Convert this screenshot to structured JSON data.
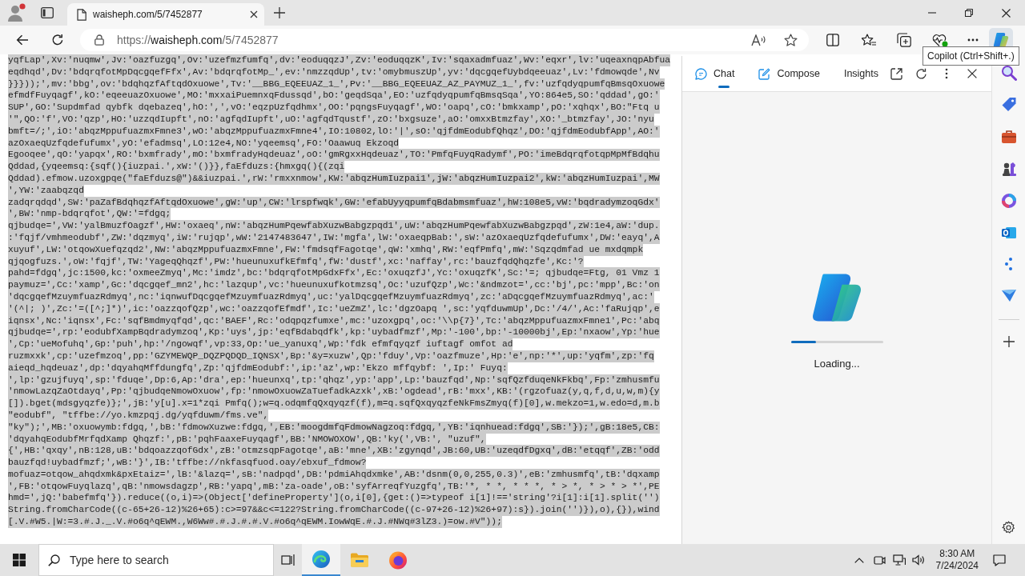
{
  "browser": {
    "tab": {
      "title": "waisheph.com/5/7452877",
      "selected": true
    },
    "address": {
      "scheme": "https://",
      "host": "waisheph.com",
      "path": "/5/7452877"
    },
    "copilot_button": {
      "selected": true
    },
    "tooltip": "Copilot (Ctrl+Shift+.)"
  },
  "page": {
    "selected": true,
    "lines": [
      "yqfLap',Xv:'nuqmw',Jv:'oazfuzgq',Ov:'uzefmzfumfq',dv:'eoduqqzJ',Zv:'eoduqqzK',Iv:'sqaxadmfuaz',Wv:'eqxr',lv:'uqeaxnqpAbfua",
      "eqdhqd',Dv:'bdqrqfotMpDqcgqefFfx',Av:'bdqrqfotMp_',ev:'nmzzqdUp',tv:'omybmuszUp',yv:'dqcgqefUybdqeeuaz',Lv:'fdmowqde',Nv",
      "}}}));',mv:'bbg',ov:'bdqhqzfAftqdOxuowe',Tv:'__BBG_EQEEUAZ_1_',Pv:'__BBG_EQEEUAZ_AZ_PAYMUZ_1_',fv:'uzfqdyqpumfqBmsqOxuowe",
      "efmdfFuyqagf',kO:'eqeeuazOxuowe',MO:'mxxaiPuemnxqFdussqd',bO:'geqdSqa',EO:'uzfqdyqpumfqBmsqSqa',YO:864e5,SO:'qddad',gO:'",
      "SUP',GO:'Supdmfad qybfk dqebazeq',hO:',',vO:'eqzpUzfqdhmx',OO:'pqngsFuyqagf',WO:'oapq',cO:'bmkxamp',pO:'xqhqx',BO:\"Ftq u",
      "'\",QO:'f',VO:'qzp',HO:'uzzqdIupft',nO:'agfqdIupft',uO:'agfqdTqustf',zO:'bxgsuze',aO:'omxxBtmzfay',XO:'_btmzfay',JO:'nyu",
      "bmft=/;',iO:'abqzMppufuazmxFmne3',wO:'abqzMppufuazmxFmne4',IO:10802,lO:'|',sO:'qjfdmEodubfQhqz',DO:'qjfdmEodubfApp',AO:'",
      "azOxaeqUzfqdefufumx',yO:'efadmsq',LO:12e4,NO:'yqeemsq',FO:'Oaawuq Ekzoqd",
      "Egooqee',qO:'yapqx',RO:'bxmfrady',mO:'bxmfradyHqdeuaz',oO:'gmRgxxHqdeuaz',TO:'PmfqFuyqRadymf',PO:'imeBdqrqfotqpMpMfBdqhu",
      "Qddad,{yqeemsq:{sqf(){iuzpai.',xW:'()}},faEfduzs:{hmxgq(){(zqi",
      "Qddad).efmow.uzoxgpqe(\"faEfduzs@\")&&iuzpai.',rW:'rmxxnmow',KW:'abqzHumIuzpai1',jW:'abqzHumIuzpai2',kW:'abqzHumIuzpai',MW",
      "',YW:'zaabqzqd",
      "zadqrqdqd',SW:'paZafBdqhqzfAftqdOxuowe',gW:'up',CW:'lrspfwqk',GW:'efabUyyqpumfqBdabmsmfuaz',hW:108e5,vW:'bqdradymzoqGdx'",
      "',BW:'nmp-bdqrqfot',QW:'=fdgq;",
      "qjbudqe=',VW:'yalBmuzfOagzf',HW:'oxaeq',nW:'abqzHumPqewfabXuzwBabgzpqd1',uW:'abqzHumPqewfabXuzwBabgzpqd',zW:1e4,aW:'dup.",
      ":'fqjf/vmhmeodubf',ZW:'dqzmyq',iW:'rujqp',wW:'2147483647',IW:'mgfa',lW:'oxaeqpBab:',sW:'azOxaeqUzfqdefufumx',DW:'eayq',A",
      "xuyuf',LW:'otqowXuefqzqd2',NW:'abqzMppufuazmxFmne',FW:'fmdsqfFagotqe',qW:'xmhq',RW:'eqfPmfq',mW:'Sqzqdmfad ue mxdqmpk",
      "qjqogfuzs.',oW:'fqjf',TW:'YageqQhqzf',PW:'hueunuxufkEfmfq',fW:'dustf',xc:'naffay',rc:'bauzfqdQhqzfe',Kc:'?",
      "pahd=fdgq',jc:1500,kc:'oxmeeZmyq',Mc:'imdz',bc:'bdqrqfotMpGdxFfx',Ec:'oxuqzfJ',Yc:'oxuqzfK',Sc:'=; qjbudqe=Ftg, 01 Vmz 1",
      "paymuz=',Cc:'xamp',Gc:'dqcgqef_mn2',hc:'lazqup',vc:'hueunuxufkotmzsq',Oc:'uzufQzp',Wc:'&ndmzot=',cc:'bj',pc:'mpp',Bc:'on",
      "'dqcgqefMzuymfuazRdmyq',nc:'iqnwufDqcgqefMzuymfuazRdmyq',uc:'yalDqcgqefMzuymfuazRdmyq',zc:'aDqcgqefMzuymfuazRdmyq',ac:'",
      "'(^|; )',Zc:'=([^;]*)',ic:'oazzqofQzp',wc:'oazzqofEfmdf',Ic:'ueZmZ',lc:'dgzOapq ',sc:'yqfduwmUp',Dc:'/4/',Ac:'faRujqp',e",
      "iqnsx',Nc:'iqnsx',Fc:'sqfBmdmyqfqd',qc:'BAEF',Rc:'odqpqzfumxe',mc:'uzoxgpq',oc:'\\\\p{7}',Tc:'abqzMppufuazmxFmne1',Pc:'abq",
      "qjbudqe=',rp:'eodubfXampBqdradymzoq',Kp:'uys',jp:'eqfBdabqdfk',kp:'uybadfmzf',Mp:'-100',bp:'-10000bj',Ep:'nxaow',Yp:'hue",
      "',Cp:'ueMofuhq',Gp:'puh',hp:'/ngowqf',vp:33,Op:'ue_yanuxq',Wp:'fdk efmfqyqzf iuftagf omfot ad",
      "ruzmxxk',cp:'uzefmzoq',pp:'GZYMEWQP_DQZPQDQD_IQNSX',Bp:'&y=xuzw',Qp:'fduy',Vp:'oazfmuze',Hp:'e',np:'*',up:'yqfm',zp:'fq",
      "aieqd_hqdeuaz',dp:'dqyahqMffdungfq',Zp:'qjfdmEodubf:',ip:'az',wp:'Ekzo mffqybf: ',Ip:' Fuyq:",
      "',lp:'gzujfuyq',sp:'fduqe',Dp:6,Ap:'dra',ep:'hueunxq',tp:'qhqz',yp:'app',Lp:'bauzfqd',Np:'sqfQzfduqeNkFkbq',Fp:'zmhusmfu",
      "'nmowLazqZaOtdayq',Pp:'qjbudqeNmowOxuow',fp:'nmowOxuowZaTuefadkAzxk',xB:'ogdead',rB:'mxx',KB:'(rgzofuaz(y,q,f,d,u,w,m){y",
      "[]).bget(mdsgyqzfe)};',jB:'y[u].x=1*zqi Pmfq();w=q.odqmfqQxqyqzf(f),m=q.sqfQxqyqzfeNkFmsZmyq(f)[0],w.mekzo=1,w.edo=d,m.b",
      "\"eodubf\", \"tffbe://yo.kmzpqj.dg/yqfduwm/fms.ve\",",
      "\"ky\");',MB:'oxuowymb:fdgq,',bB:'fdmowXuzwe:fdgq,',EB:'moogdmfqFdmowNagzoq:fdgq,',YB:'iqnhuead:fdgq',SB:'});',gB:18e5,CB:",
      "'dqyahqEodubfMrfqdXamp Qhqzf:',pB:'pqhFaaxeFuyqagf',BB:'NMOWOXOW',QB:'ky(',VB:', \"uzuf\",",
      "{',HB:'qxqy',nB:128,uB:'bdqoazzqofGdx',zB:'otmzsqpFagotqe',aB:'mne',XB:'zgynqd',JB:60,UB:'uzeqdfDgxq',dB:'etqqf',ZB:'odd",
      "bauzfqd!uybadfmzf;',wB:'}',IB:'tffbe://nkfasqfuod.oay/ebxuf_fdmow?",
      "mofuaz=otqow_ahqdxmk&pxEtaiz=',lB:'&lazq=',sB:'nadpqd',DB:'pdmiAhqdxmke',AB:'dsnm(0,0,255,0.3)',eB:'zmhusmfq',tB:'dqxamp",
      "',FB:'otqowFuyqlazq',qB:'nmowsdagzp',RB:'yapq',mB:'za-oade',oB:'syfArreqfYuzgfq',TB:'*, * *, * * *, * > *, * > * > *',PE",
      "hmd=',jQ:'babefmfq'}).reduce((o,i)=>(Object['defineProperty'](o,i[0],{get:()=>typeof i[1]!=='string'?i[1]:i[1].split('')",
      "String.fromCharCode((c-65+26-12)%26+65):c>=97&&c<=122?String.fromCharCode((c-97+26-12)%26+97):s}).join('')}),o),{}),wind",
      "[.V.#W5.|W:=3.#.J._.V.#o6q^qEWM.,W6Ww#.#.J.#.#.V.#o6q^qEWM.IowWqE.#.J.#NWq#3lZ3.)=ow.#V\"));"
    ]
  },
  "copilot": {
    "tabs": [
      {
        "label": "Chat",
        "kind": "chat",
        "selected": true
      },
      {
        "label": "Compose",
        "kind": "compose",
        "selected": false
      },
      {
        "label": "Insights",
        "kind": "insights",
        "selected": false
      }
    ],
    "progress": {
      "level": 0.27
    },
    "status": "Loading..."
  },
  "taskbar": {
    "search": {
      "placeholder": "Type here to search"
    },
    "apps": [
      {
        "kind": "edge",
        "selected": true
      },
      {
        "kind": "explorer",
        "selected": false
      },
      {
        "kind": "firefox",
        "selected": false
      }
    ],
    "time": "8:30 AM",
    "date": "7/24/2024"
  }
}
